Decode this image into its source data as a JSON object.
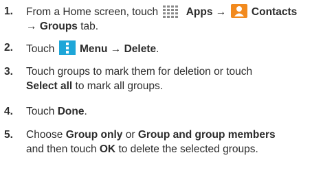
{
  "colors": {
    "text": "#2b2b2b",
    "apps_icon": "#8a8a8a",
    "contacts_icon_bg": "#f28a1e",
    "menu_icon_bg": "#1ea6d8"
  },
  "steps": [
    {
      "number": "1.",
      "line1_pre": "From a Home screen, touch",
      "apps_icon": "apps-grid-icon",
      "apps_label": "Apps",
      "arrow1": "→",
      "contacts_icon": "contacts-person-icon",
      "contacts_label": "Contacts",
      "line2_arrow": "→",
      "groups_tab_label": "Groups",
      "line2_post": "tab."
    },
    {
      "number": "2.",
      "pre": "Touch",
      "menu_icon": "vertical-dots-menu-icon",
      "menu_label": "Menu",
      "arrow": "→",
      "delete_label": "Delete",
      "post": "."
    },
    {
      "number": "3.",
      "line1": "Touch groups to mark them for deletion or touch",
      "select_all_label": "Select all",
      "line2_post": "to mark all groups."
    },
    {
      "number": "4.",
      "pre": "Touch",
      "done_label": "Done",
      "post": "."
    },
    {
      "number": "5.",
      "pre": "Choose",
      "group_only_label": "Group only",
      "or": "or",
      "group_members_label": "Group and group members",
      "line2_pre": "and then touch",
      "ok_label": "OK",
      "line2_post": "to delete the selected groups."
    }
  ]
}
